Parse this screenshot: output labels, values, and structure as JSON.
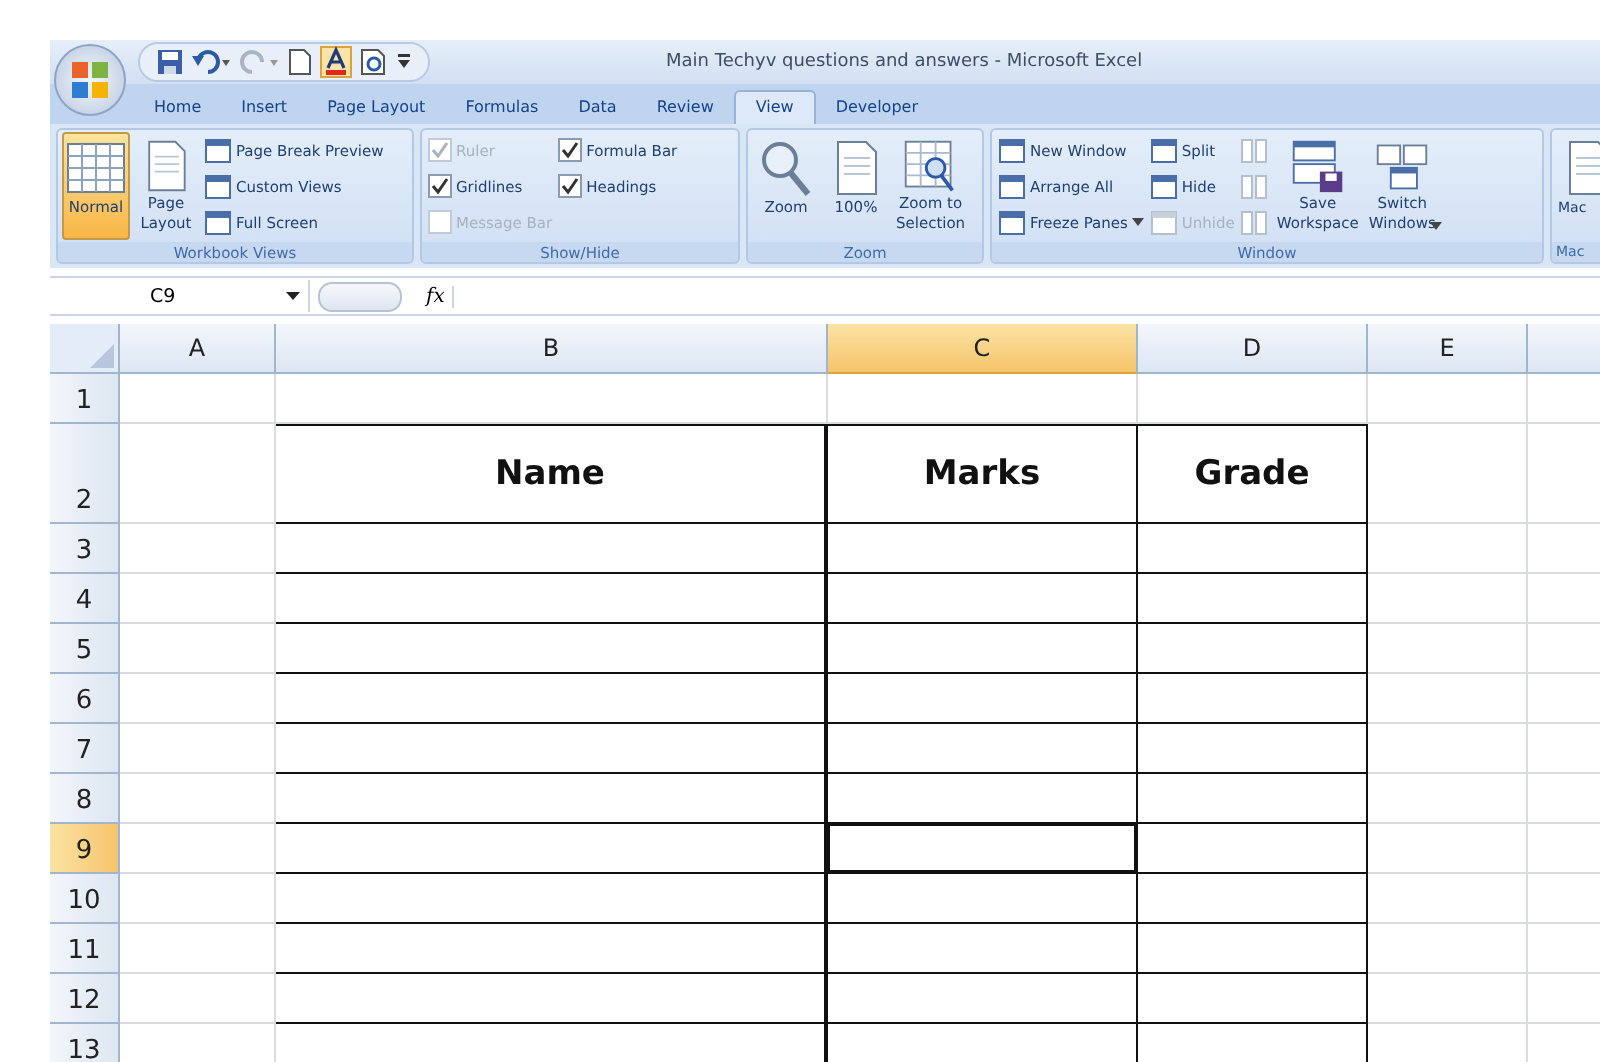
{
  "window": {
    "title": "Main Techyv questions and answers - Microsoft Excel"
  },
  "tabs": [
    {
      "label": "Home",
      "selected": false
    },
    {
      "label": "Insert",
      "selected": false
    },
    {
      "label": "Page Layout",
      "selected": false
    },
    {
      "label": "Formulas",
      "selected": false
    },
    {
      "label": "Data",
      "selected": false
    },
    {
      "label": "Review",
      "selected": false
    },
    {
      "label": "View",
      "selected": true
    },
    {
      "label": "Developer",
      "selected": false
    }
  ],
  "ribbon": [
    {
      "label": "Workbook Views",
      "columns": [
        [
          {
            "kind": "big",
            "label": "Normal",
            "selected": true
          }
        ],
        [
          {
            "kind": "big",
            "label": "Page\nLayout",
            "selected": false
          }
        ],
        [
          {
            "kind": "small",
            "label": "Page Break Preview",
            "disabled": false
          },
          {
            "kind": "small",
            "label": "Custom Views",
            "disabled": false
          },
          {
            "kind": "small",
            "label": "Full Screen",
            "disabled": false
          }
        ]
      ]
    },
    {
      "label": "Show/Hide",
      "columns": [
        [
          {
            "kind": "check",
            "label": "Ruler",
            "checked": true,
            "disabled": true
          },
          {
            "kind": "check",
            "label": "Gridlines",
            "checked": true,
            "disabled": false
          },
          {
            "kind": "check",
            "label": "Message Bar",
            "checked": false,
            "disabled": true
          }
        ],
        [
          {
            "kind": "check",
            "label": "Formula Bar",
            "checked": true,
            "disabled": false
          },
          {
            "kind": "check",
            "label": "Headings",
            "checked": true,
            "disabled": false
          }
        ]
      ]
    },
    {
      "label": "Zoom",
      "columns": [
        [
          {
            "kind": "big",
            "label": "Zoom",
            "selected": false
          }
        ],
        [
          {
            "kind": "big",
            "label": "100%",
            "selected": false
          }
        ],
        [
          {
            "kind": "big",
            "label": "Zoom to\nSelection",
            "selected": false
          }
        ]
      ]
    },
    {
      "label": "Window",
      "columns": [
        [
          {
            "kind": "small",
            "label": "New Window",
            "disabled": false
          },
          {
            "kind": "small",
            "label": "Arrange All",
            "disabled": false
          },
          {
            "kind": "small",
            "label": "Freeze Panes",
            "dropdown": true,
            "disabled": false
          }
        ],
        [
          {
            "kind": "small",
            "label": "Split",
            "disabled": false
          },
          {
            "kind": "small",
            "label": "Hide",
            "disabled": false
          },
          {
            "kind": "small",
            "label": "Unhide",
            "disabled": true
          }
        ],
        [
          {
            "kind": "iconbtn",
            "disabled": true
          },
          {
            "kind": "iconbtn",
            "disabled": true
          },
          {
            "kind": "iconbtn",
            "disabled": true
          }
        ],
        [
          {
            "kind": "big",
            "label": "Save\nWorkspace",
            "selected": false
          }
        ],
        [
          {
            "kind": "big",
            "label": "Switch\nWindows",
            "selected": false,
            "dropdown": true
          }
        ]
      ]
    },
    {
      "label": "Mac",
      "columns": [
        [
          {
            "kind": "big",
            "label": "Mac",
            "selected": false
          }
        ]
      ]
    }
  ],
  "formula_bar": {
    "name_box": "C9",
    "function_label": "fx"
  },
  "grid": {
    "columns": [
      {
        "label": "A",
        "selected": false
      },
      {
        "label": "B",
        "selected": false
      },
      {
        "label": "C",
        "selected": true
      },
      {
        "label": "D",
        "selected": false
      },
      {
        "label": "E",
        "selected": false
      }
    ],
    "rows": [
      {
        "label": "1",
        "kind": "blank",
        "selected": false
      },
      {
        "label": "2",
        "kind": "table_header",
        "selected": false,
        "cells": [
          "Name",
          "Marks",
          "Grade"
        ]
      },
      {
        "label": "3",
        "kind": "table",
        "selected": false
      },
      {
        "label": "4",
        "kind": "table",
        "selected": false
      },
      {
        "label": "5",
        "kind": "table",
        "selected": false
      },
      {
        "label": "6",
        "kind": "table",
        "selected": false
      },
      {
        "label": "7",
        "kind": "table",
        "selected": false
      },
      {
        "label": "8",
        "kind": "table",
        "selected": false
      },
      {
        "label": "9",
        "kind": "table",
        "selected": true
      },
      {
        "label": "10",
        "kind": "table",
        "selected": false
      },
      {
        "label": "11",
        "kind": "table",
        "selected": false
      },
      {
        "label": "12",
        "kind": "table",
        "selected": false
      },
      {
        "label": "13",
        "kind": "table",
        "selected": false
      }
    ]
  }
}
